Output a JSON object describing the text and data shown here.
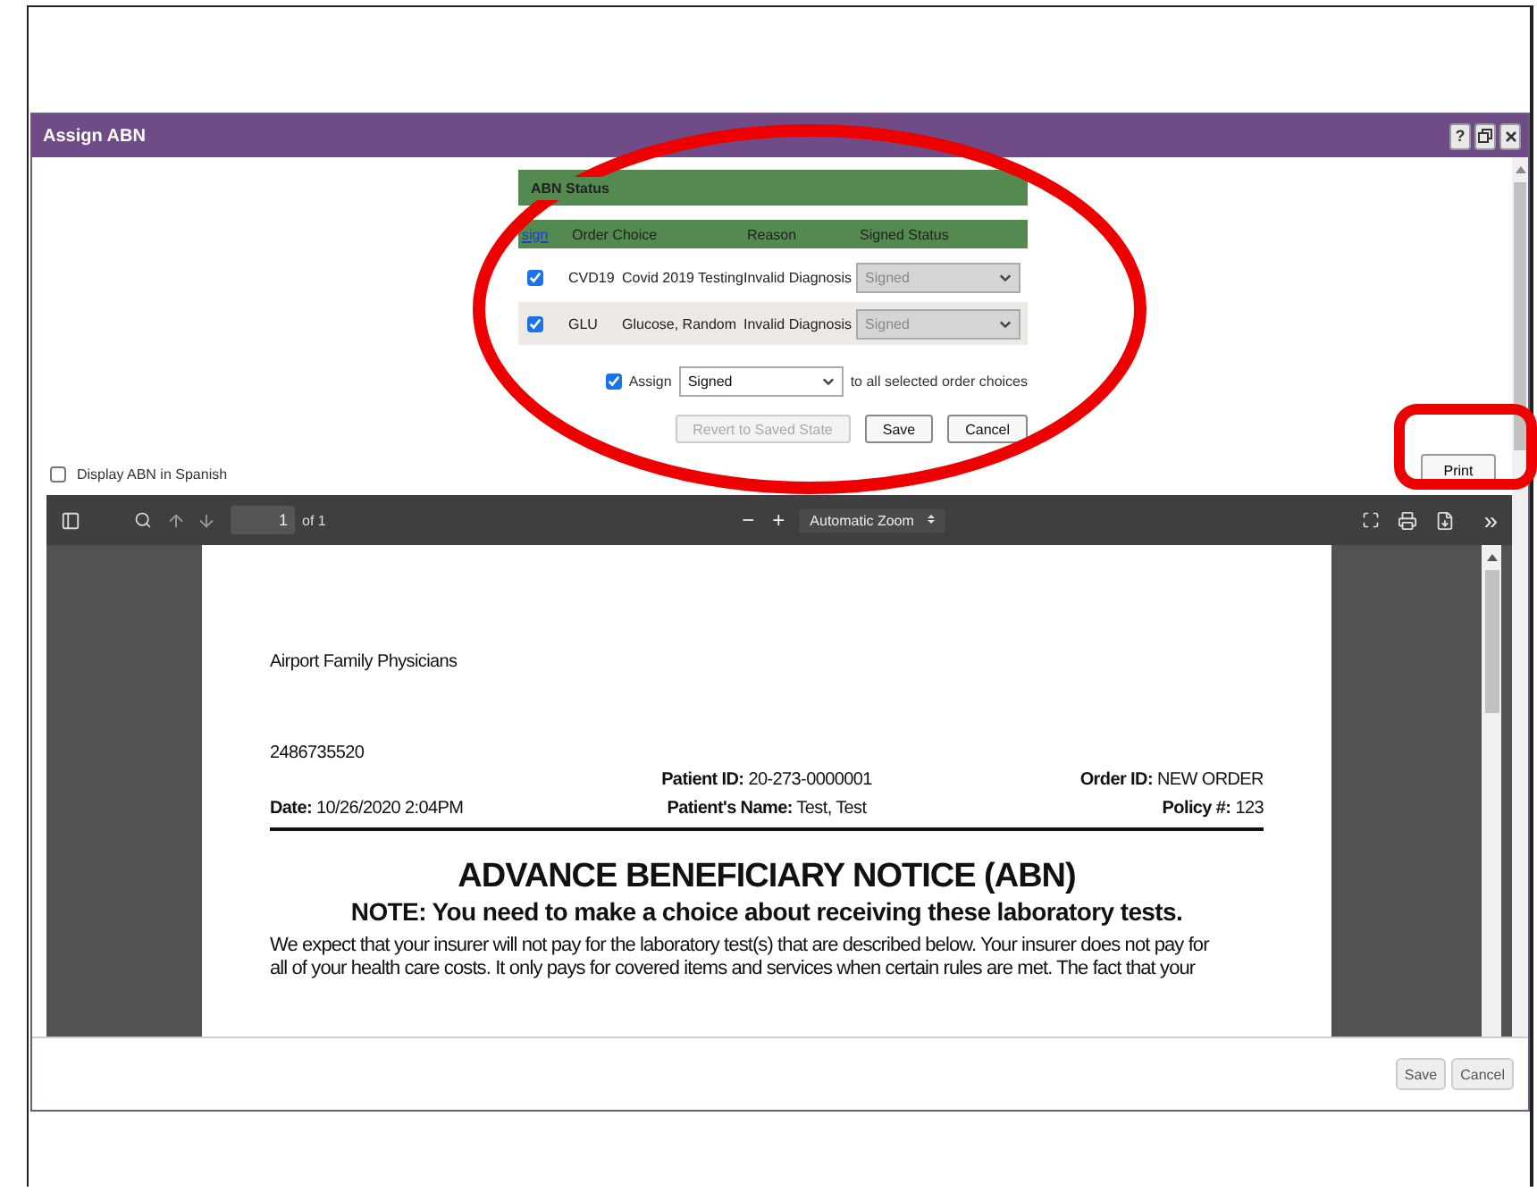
{
  "window": {
    "title": "Assign ABN",
    "help": "?"
  },
  "abn_status": {
    "title": "ABN Status",
    "columns": [
      "sign",
      "Order Choice",
      "Reason",
      "Signed Status"
    ],
    "rows": [
      {
        "checked": true,
        "code": "CVD19",
        "name": "Covid 2019 Testing",
        "reason": "Invalid Diagnosis",
        "status": "Signed"
      },
      {
        "checked": true,
        "code": "GLU",
        "name": "Glucose, Random",
        "reason": "Invalid Diagnosis",
        "status": "Signed"
      }
    ],
    "assign": {
      "checked": true,
      "label": "Assign",
      "value": "Signed",
      "suffix": "to all selected order choices"
    },
    "buttons": [
      {
        "label": "Revert to Saved State",
        "disabled": true
      },
      {
        "label": "Save",
        "disabled": false
      },
      {
        "label": "Cancel",
        "disabled": false
      }
    ]
  },
  "spanish": {
    "label": "Display ABN in Spanish",
    "checked": false
  },
  "print_button": "Print",
  "pdf_toolbar": {
    "page": "1",
    "page_count": "of 1",
    "zoom_out": "−",
    "zoom_in": "+",
    "zoom": "Automatic Zoom",
    "more": "»"
  },
  "document": {
    "practice": "Airport Family Physicians",
    "phone": "2486735520",
    "fields": [
      {
        "text": "**Patient ID:** 20-273-0000001"
      },
      {
        "text": "**Order ID:** NEW ORDER"
      },
      {
        "text": "**Date:** 10/26/2020 2:04PM"
      },
      {
        "text": "**Patient's Name:** Test, Test"
      },
      {
        "text": "**Policy #:** 123"
      }
    ],
    "title": "ADVANCE BENEFICIARY NOTICE (ABN)",
    "note": "NOTE: You need to make a choice about receiving these laboratory tests.",
    "paragraph_lines": [
      "We expect that your insurer will not pay for the laboratory test(s) that are described below. Your insurer does not pay for",
      "all of your health care costs. It only pays for covered items and services when certain rules are met. The fact that your"
    ]
  },
  "footer_buttons": [
    {
      "label": "Save"
    },
    {
      "label": "Cancel"
    }
  ],
  "annotations": {
    "ellipse": true,
    "rectangle": true
  }
}
